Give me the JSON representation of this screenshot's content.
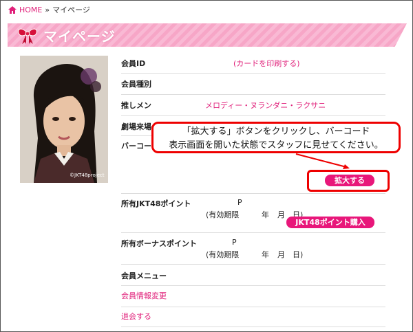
{
  "breadcrumb": {
    "home": "HOME",
    "separator": "»",
    "current": "マイページ"
  },
  "header": {
    "title": "マイページ",
    "icon": "ribbon-icon"
  },
  "member_id": {
    "label": "会員ID",
    "print_link_prefix": "(",
    "print_link": "カードを印刷する",
    "print_link_suffix": ")"
  },
  "member_type": {
    "label": "会員種別"
  },
  "oshimen": {
    "label": "推しメン",
    "value": "メロディー・ヌランダニ・ラクサニ"
  },
  "theater": {
    "label": "劇場来場"
  },
  "barcode": {
    "label": "バーコード"
  },
  "callout": {
    "line1": "「拡大する」ボタンをクリックし、バーコード",
    "line2": "表示画面を開いた状態でスタッフに見せてください。"
  },
  "expand_button": "拡大する",
  "points": {
    "label": "所有JKT48ポイント",
    "unit": "P",
    "expiry_prefix": "(有効期限",
    "year": "年",
    "month": "月",
    "day": "日)",
    "buy_button": "JKT48ポイント購入"
  },
  "bonus": {
    "label": "所有ボーナスポイント",
    "unit": "P",
    "expiry_prefix": "(有効期限",
    "year": "年",
    "month": "月",
    "day": "日)"
  },
  "menu": {
    "label": "会員メニュー",
    "items": [
      "会員情報変更",
      "退会する"
    ]
  },
  "photo": {
    "watermark": "©JKT48project"
  },
  "colors": {
    "accent": "#e0207a",
    "button": "#e8177a",
    "banner": "#f7a6c7",
    "annotation": "#ee0000"
  }
}
